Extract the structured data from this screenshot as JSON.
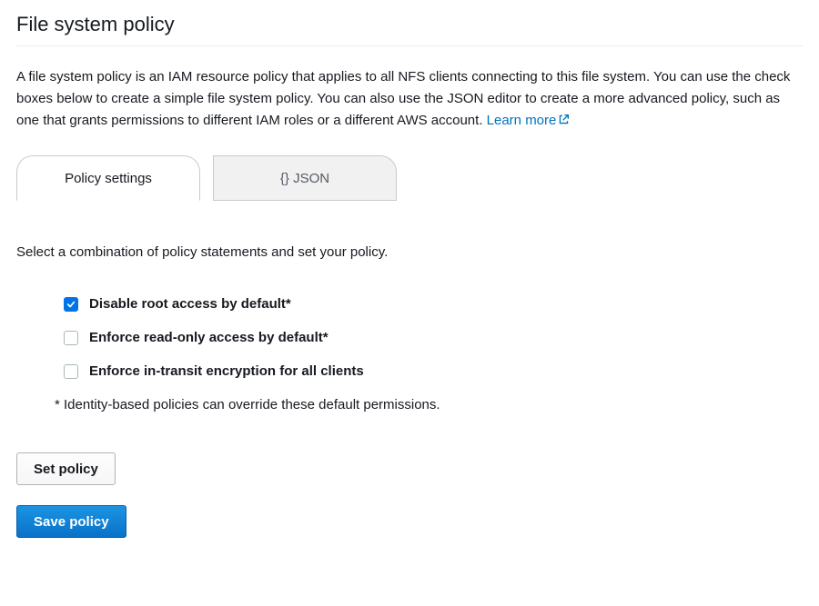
{
  "header": {
    "title": "File system policy"
  },
  "description": {
    "text": "A file system policy is an IAM resource policy that applies to all NFS clients connecting to this file system. You can use the check boxes below to create a simple file system policy. You can also use the JSON editor to create a more advanced policy, such as one that grants permissions to different IAM roles or a different AWS account. ",
    "learn_more": "Learn more"
  },
  "tabs": {
    "settings": "Policy settings",
    "json": "{} JSON"
  },
  "instructions": "Select a combination of policy statements and set your policy.",
  "options": [
    {
      "label": "Disable root access by default*",
      "checked": true
    },
    {
      "label": "Enforce read-only access by default*",
      "checked": false
    },
    {
      "label": "Enforce in-transit encryption for all clients",
      "checked": false
    }
  ],
  "footnote": "* Identity-based policies can override these default permissions.",
  "buttons": {
    "set": "Set policy",
    "save": "Save policy"
  }
}
